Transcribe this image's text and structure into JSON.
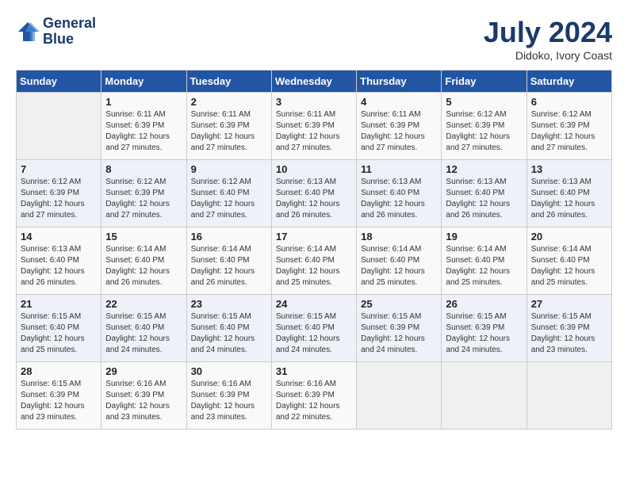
{
  "header": {
    "logo_line1": "General",
    "logo_line2": "Blue",
    "month": "July 2024",
    "location": "Didoko, Ivory Coast"
  },
  "weekdays": [
    "Sunday",
    "Monday",
    "Tuesday",
    "Wednesday",
    "Thursday",
    "Friday",
    "Saturday"
  ],
  "weeks": [
    [
      {
        "day": "",
        "info": ""
      },
      {
        "day": "1",
        "info": "Sunrise: 6:11 AM\nSunset: 6:39 PM\nDaylight: 12 hours\nand 27 minutes."
      },
      {
        "day": "2",
        "info": "Sunrise: 6:11 AM\nSunset: 6:39 PM\nDaylight: 12 hours\nand 27 minutes."
      },
      {
        "day": "3",
        "info": "Sunrise: 6:11 AM\nSunset: 6:39 PM\nDaylight: 12 hours\nand 27 minutes."
      },
      {
        "day": "4",
        "info": "Sunrise: 6:11 AM\nSunset: 6:39 PM\nDaylight: 12 hours\nand 27 minutes."
      },
      {
        "day": "5",
        "info": "Sunrise: 6:12 AM\nSunset: 6:39 PM\nDaylight: 12 hours\nand 27 minutes."
      },
      {
        "day": "6",
        "info": "Sunrise: 6:12 AM\nSunset: 6:39 PM\nDaylight: 12 hours\nand 27 minutes."
      }
    ],
    [
      {
        "day": "7",
        "info": ""
      },
      {
        "day": "8",
        "info": "Sunrise: 6:12 AM\nSunset: 6:39 PM\nDaylight: 12 hours\nand 27 minutes."
      },
      {
        "day": "9",
        "info": "Sunrise: 6:12 AM\nSunset: 6:40 PM\nDaylight: 12 hours\nand 27 minutes."
      },
      {
        "day": "10",
        "info": "Sunrise: 6:13 AM\nSunset: 6:40 PM\nDaylight: 12 hours\nand 26 minutes."
      },
      {
        "day": "11",
        "info": "Sunrise: 6:13 AM\nSunset: 6:40 PM\nDaylight: 12 hours\nand 26 minutes."
      },
      {
        "day": "12",
        "info": "Sunrise: 6:13 AM\nSunset: 6:40 PM\nDaylight: 12 hours\nand 26 minutes."
      },
      {
        "day": "13",
        "info": "Sunrise: 6:13 AM\nSunset: 6:40 PM\nDaylight: 12 hours\nand 26 minutes."
      }
    ],
    [
      {
        "day": "14",
        "info": ""
      },
      {
        "day": "15",
        "info": "Sunrise: 6:14 AM\nSunset: 6:40 PM\nDaylight: 12 hours\nand 26 minutes."
      },
      {
        "day": "16",
        "info": "Sunrise: 6:14 AM\nSunset: 6:40 PM\nDaylight: 12 hours\nand 26 minutes."
      },
      {
        "day": "17",
        "info": "Sunrise: 6:14 AM\nSunset: 6:40 PM\nDaylight: 12 hours\nand 25 minutes."
      },
      {
        "day": "18",
        "info": "Sunrise: 6:14 AM\nSunset: 6:40 PM\nDaylight: 12 hours\nand 25 minutes."
      },
      {
        "day": "19",
        "info": "Sunrise: 6:14 AM\nSunset: 6:40 PM\nDaylight: 12 hours\nand 25 minutes."
      },
      {
        "day": "20",
        "info": "Sunrise: 6:14 AM\nSunset: 6:40 PM\nDaylight: 12 hours\nand 25 minutes."
      }
    ],
    [
      {
        "day": "21",
        "info": ""
      },
      {
        "day": "22",
        "info": "Sunrise: 6:15 AM\nSunset: 6:40 PM\nDaylight: 12 hours\nand 24 minutes."
      },
      {
        "day": "23",
        "info": "Sunrise: 6:15 AM\nSunset: 6:40 PM\nDaylight: 12 hours\nand 24 minutes."
      },
      {
        "day": "24",
        "info": "Sunrise: 6:15 AM\nSunset: 6:40 PM\nDaylight: 12 hours\nand 24 minutes."
      },
      {
        "day": "25",
        "info": "Sunrise: 6:15 AM\nSunset: 6:39 PM\nDaylight: 12 hours\nand 24 minutes."
      },
      {
        "day": "26",
        "info": "Sunrise: 6:15 AM\nSunset: 6:39 PM\nDaylight: 12 hours\nand 24 minutes."
      },
      {
        "day": "27",
        "info": "Sunrise: 6:15 AM\nSunset: 6:39 PM\nDaylight: 12 hours\nand 23 minutes."
      }
    ],
    [
      {
        "day": "28",
        "info": "Sunrise: 6:15 AM\nSunset: 6:39 PM\nDaylight: 12 hours\nand 23 minutes."
      },
      {
        "day": "29",
        "info": "Sunrise: 6:16 AM\nSunset: 6:39 PM\nDaylight: 12 hours\nand 23 minutes."
      },
      {
        "day": "30",
        "info": "Sunrise: 6:16 AM\nSunset: 6:39 PM\nDaylight: 12 hours\nand 23 minutes."
      },
      {
        "day": "31",
        "info": "Sunrise: 6:16 AM\nSunset: 6:39 PM\nDaylight: 12 hours\nand 22 minutes."
      },
      {
        "day": "",
        "info": ""
      },
      {
        "day": "",
        "info": ""
      },
      {
        "day": "",
        "info": ""
      }
    ]
  ],
  "row14_sun": "Sunrise: 6:13 AM\nSunset: 6:40 PM\nDaylight: 12 hours\nand 26 minutes.",
  "row21_sun": "Sunrise: 6:15 AM\nSunset: 6:40 PM\nDaylight: 12 hours\nand 25 minutes."
}
